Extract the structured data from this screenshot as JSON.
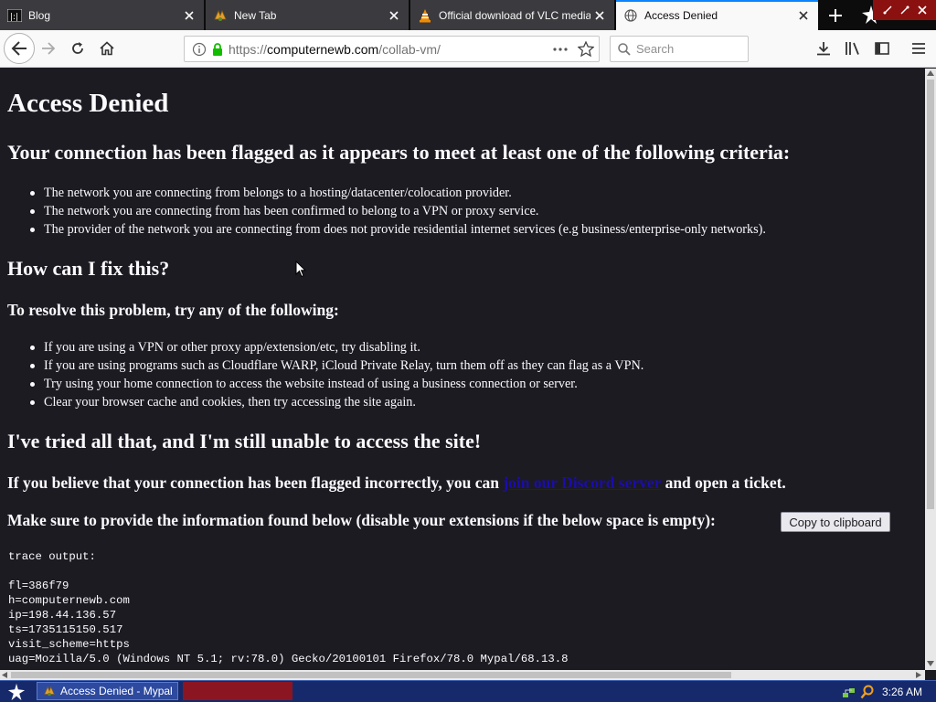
{
  "tabs": [
    {
      "title": "Blog",
      "icon": "blog-favicon-icon"
    },
    {
      "title": "New Tab",
      "icon": "mypal-favicon-icon"
    },
    {
      "title": "Official download of VLC media pla",
      "icon": "vlc-cone-icon"
    },
    {
      "title": "Access Denied",
      "icon": "globe-icon"
    }
  ],
  "navbar": {
    "url_prefix": "https://",
    "url_host": "computernewb.com",
    "url_path": "/collab-vm/",
    "search_placeholder": "Search"
  },
  "page": {
    "heading": "Access Denied",
    "flag_heading": "Your connection has been flagged as it appears to meet at least one of the following criteria:",
    "criteria": [
      "The network you are connecting from belongs to a hosting/datacenter/colocation provider.",
      "The network you are connecting from has been confirmed to belong to a VPN or proxy service.",
      "The provider of the network you are connecting from does not provide residential internet services (e.g business/enterprise-only networks)."
    ],
    "fix_heading": "How can I fix this?",
    "resolve_heading": "To resolve this problem, try any of the following:",
    "fixes": [
      "If you are using a VPN or other proxy app/extension/etc, try disabling it.",
      "If you are using programs such as Cloudflare WARP, iCloud Private Relay, turn them off as they can flag as a VPN.",
      "Try using your home connection to access the website instead of using a business connection or server.",
      "Clear your browser cache and cookies, then try accessing the site again."
    ],
    "tried_heading": "I've tried all that, and I'm still unable to access the site!",
    "incorrect_prefix": "If you believe that your connection has been flagged incorrectly, you can ",
    "discord_link": "join our Discord server",
    "incorrect_suffix": " and open a ticket.",
    "provide_info": "Make sure to provide the information found below (disable your extensions if the below space is empty):",
    "copy_button": "Copy to clipboard",
    "trace_output": "trace output:\n\nfl=386f79\nh=computernewb.com\nip=198.44.136.57\nts=1735115150.517\nvisit_scheme=https\nuag=Mozilla/5.0 (Windows NT 5.1; rv:78.0) Gecko/20100101 Firefox/78.0 Mypal/68.13.8"
  },
  "taskbar": {
    "task_label": "Access Denied - Mypal",
    "clock": "3:26 AM"
  },
  "colors": {
    "page_background": "#1c1b22",
    "link": "#1a0dab",
    "taskbar": "#162a6b",
    "active_tab_accent": "#0a84ff"
  }
}
